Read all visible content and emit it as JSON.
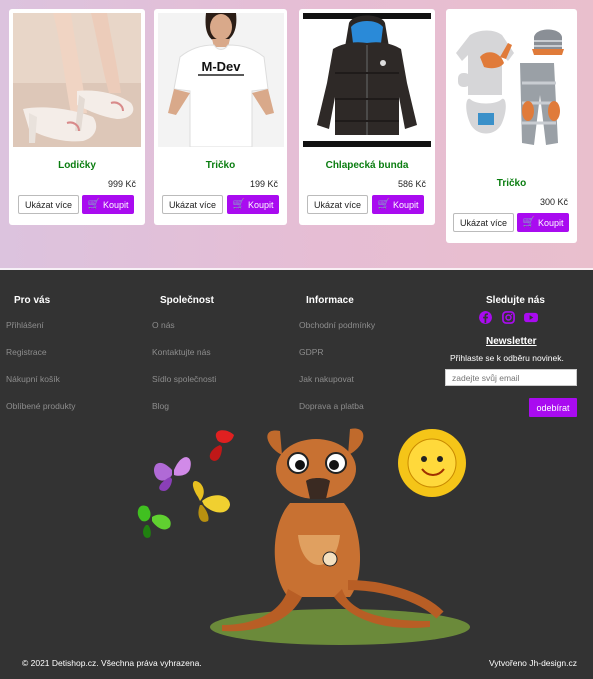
{
  "products": [
    {
      "name": "Lodičky",
      "price": "999 Kč",
      "more_label": "Ukázat více",
      "buy_label": "Koupit",
      "image": "high-heel-shoes"
    },
    {
      "name": "Tričko",
      "price": "199 Kč",
      "more_label": "Ukázat více",
      "buy_label": "Koupit",
      "image": "t-shirt",
      "shirt_text": "M-Dev"
    },
    {
      "name": "Chlapecká bunda",
      "price": "586 Kč",
      "more_label": "Ukázat více",
      "buy_label": "Koupit",
      "image": "boys-jacket"
    },
    {
      "name": "Tričko",
      "price": "300 Kč",
      "more_label": "Ukázat více",
      "buy_label": "Koupit",
      "image": "baby-clothes-set"
    }
  ],
  "footer": {
    "pro_vas": {
      "title": "Pro vás",
      "links": [
        "Přihlášení",
        "Registrace",
        "Nákupní košík",
        "Oblíbené produkty"
      ]
    },
    "spolecnost": {
      "title": "Společnost",
      "links": [
        "O nás",
        "Kontaktujte nás",
        "Sídlo společnosti",
        "Blog"
      ]
    },
    "informace": {
      "title": "Informace",
      "links": [
        "Obchodní podmínky",
        "GDPR",
        "Jak nakupovat",
        "Doprava a platba"
      ]
    },
    "social": {
      "title": "Sledujte nás",
      "icons": [
        "facebook-icon",
        "instagram-icon",
        "youtube-icon"
      ]
    },
    "newsletter": {
      "title": "Newsletter",
      "text": "Přihlaste se k odběru novinek.",
      "placeholder": "zadejte svůj email",
      "button": "odebírat"
    },
    "copyright": "© 2021 Detishop.cz. Všechna práva vyhrazena.",
    "made_by": "Vytvořeno Jh-design.cz"
  },
  "colors": {
    "accent": "#a90bf0",
    "product_name": "#0a7d10",
    "footer_bg": "#333333"
  }
}
